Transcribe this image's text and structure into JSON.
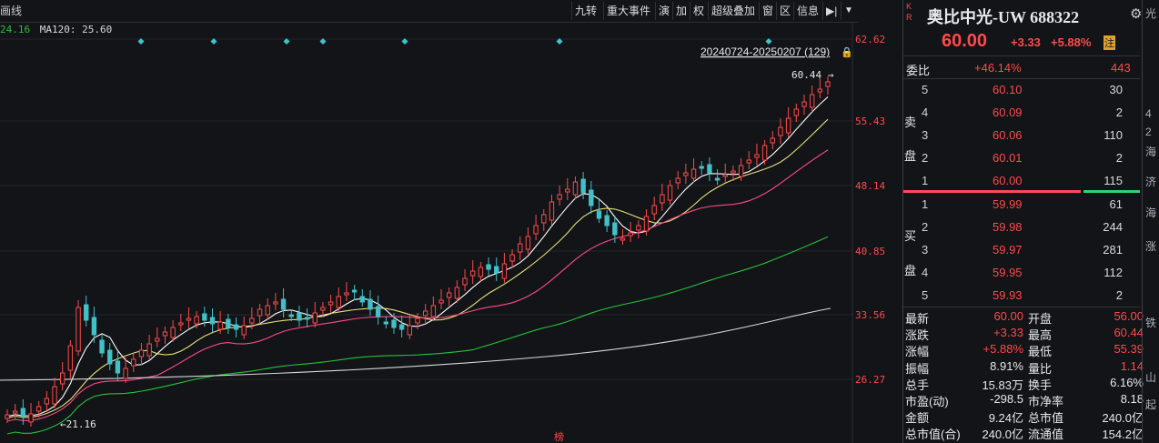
{
  "toolbar": {
    "left_label": "画线",
    "buttons": [
      "九转",
      "重大事件",
      "演",
      "加",
      "权",
      "超级叠加",
      "窗",
      "区",
      "信息"
    ],
    "pin_glyph": "▶|",
    "menu_glyph": "▼"
  },
  "ma_legend": {
    "first": "24.16",
    "ma120": "MA120: 25.60"
  },
  "price_axis": [
    "62.62",
    "55.43",
    "48.14",
    "40.85",
    "33.56",
    "26.27"
  ],
  "chart_info": {
    "range_label": "20240724-20250207 (129)",
    "high_marker": "60.44",
    "low_marker": "21.16",
    "bang_label": "榜"
  },
  "stock": {
    "kr": [
      "K",
      "R"
    ],
    "name": "奥比中光-UW 688322",
    "price": "60.00",
    "change": "+3.33",
    "change_pct": "+5.88%",
    "margin_badge": "注"
  },
  "order_book": {
    "weibi_label": "委比",
    "weibi_value": "+46.14%",
    "weicha_value": "443",
    "sell_label": [
      "卖",
      "盘"
    ],
    "buy_label": [
      "买",
      "盘"
    ],
    "sell": [
      {
        "level": "5",
        "price": "60.10",
        "volume": "30"
      },
      {
        "level": "4",
        "price": "60.09",
        "volume": "2"
      },
      {
        "level": "3",
        "price": "60.06",
        "volume": "110"
      },
      {
        "level": "2",
        "price": "60.01",
        "volume": "2"
      },
      {
        "level": "1",
        "price": "60.00",
        "volume": "115"
      }
    ],
    "buy": [
      {
        "level": "1",
        "price": "59.99",
        "volume": "61"
      },
      {
        "level": "2",
        "price": "59.98",
        "volume": "244"
      },
      {
        "level": "3",
        "price": "59.97",
        "volume": "281"
      },
      {
        "level": "4",
        "price": "59.95",
        "volume": "112"
      },
      {
        "level": "5",
        "price": "59.93",
        "volume": "2"
      }
    ]
  },
  "quote": {
    "left": [
      {
        "label": "最新",
        "value": "60.00",
        "color": "red"
      },
      {
        "label": "涨跌",
        "value": "+3.33",
        "color": "red"
      },
      {
        "label": "涨幅",
        "value": "+5.88%",
        "color": "red"
      },
      {
        "label": "振幅",
        "value": "8.91%",
        "color": "white"
      },
      {
        "label": "总手",
        "value": "15.83万",
        "color": "white"
      },
      {
        "label": "市盈(动)",
        "value": "-298.5",
        "color": "white"
      },
      {
        "label": "金额",
        "value": "9.24亿",
        "color": "white"
      },
      {
        "label": "总市值(合)",
        "value": "240.0亿",
        "color": "white"
      }
    ],
    "right": [
      {
        "label": "开盘",
        "value": "56.00",
        "color": "red"
      },
      {
        "label": "最高",
        "value": "60.44",
        "color": "red"
      },
      {
        "label": "最低",
        "value": "55.39",
        "color": "red"
      },
      {
        "label": "量比",
        "value": "1.14",
        "color": "red"
      },
      {
        "label": "换手",
        "value": "6.16%",
        "color": "white"
      },
      {
        "label": "市净率",
        "value": "8.18",
        "color": "white"
      },
      {
        "label": "总市值",
        "value": "240.0亿",
        "color": "white"
      },
      {
        "label": "流通值",
        "value": "154.2亿",
        "color": "white"
      }
    ]
  },
  "edge_glyphs": [
    "光",
    "4",
    "2",
    "海",
    "济",
    "海",
    "涨",
    "铁",
    "山",
    "起"
  ],
  "colors": {
    "up": "#ff4a4a",
    "down": "#42c0c8",
    "ma5": "#ffffff",
    "ma10": "#e6e07a",
    "ma20": "#ff4a86",
    "ma60": "#27c23a",
    "ma120": "#d8d8d8"
  }
}
